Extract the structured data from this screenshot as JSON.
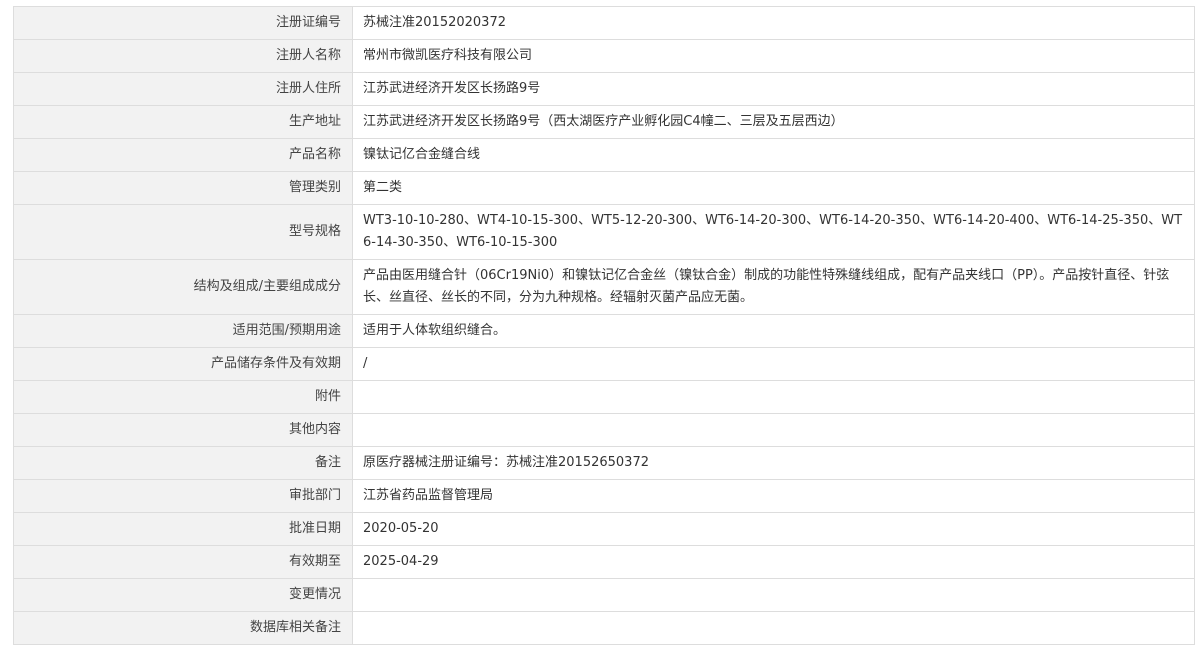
{
  "rows": [
    {
      "label": "注册证编号",
      "value": "苏械注准20152020372"
    },
    {
      "label": "注册人名称",
      "value": "常州市微凯医疗科技有限公司"
    },
    {
      "label": "注册人住所",
      "value": "江苏武进经济开发区长扬路9号"
    },
    {
      "label": "生产地址",
      "value": "江苏武进经济开发区长扬路9号（西太湖医疗产业孵化园C4幢二、三层及五层西边）"
    },
    {
      "label": "产品名称",
      "value": "镍钛记亿合金缝合线"
    },
    {
      "label": "管理类别",
      "value": "第二类"
    },
    {
      "label": "型号规格",
      "value": "WT3-10-10-280、WT4-10-15-300、WT5-12-20-300、WT6-14-20-300、WT6-14-20-350、WT6-14-20-400、WT6-14-25-350、WT6-14-30-350、WT6-10-15-300"
    },
    {
      "label": "结构及组成/主要组成成分",
      "value": "产品由医用缝合针（06Cr19Ni0）和镍钛记亿合金丝（镍钛合金）制成的功能性特殊缝线组成，配有产品夹线口（PP）。产品按针直径、针弦长、丝直径、丝长的不同，分为九种规格。经辐射灭菌产品应无菌。"
    },
    {
      "label": "适用范围/预期用途",
      "value": "适用于人体软组织缝合。"
    },
    {
      "label": "产品储存条件及有效期",
      "value": "/"
    },
    {
      "label": "附件",
      "value": ""
    },
    {
      "label": "其他内容",
      "value": ""
    },
    {
      "label": "备注",
      "value": "原医疗器械注册证编号：苏械注准20152650372"
    },
    {
      "label": "审批部门",
      "value": "江苏省药品监督管理局"
    },
    {
      "label": "批准日期",
      "value": "2020-05-20"
    },
    {
      "label": "有效期至",
      "value": "2025-04-29"
    },
    {
      "label": "变更情况",
      "value": ""
    },
    {
      "label": "数据库相关备注",
      "value": ""
    }
  ]
}
